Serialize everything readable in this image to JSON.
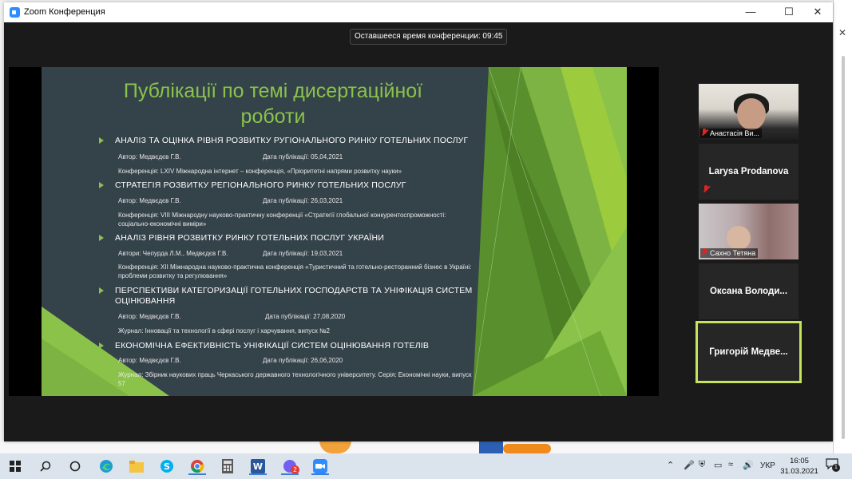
{
  "window": {
    "title": "Zoom Конференция",
    "timer": "Оставшееся время конференции: 09:45"
  },
  "slide": {
    "title": "Публікації по темі дисертаційної роботи",
    "publications": [
      {
        "heading": "АНАЛІЗ ТА ОЦІНКА РІВНЯ РОЗВИТКУ РУГІОНАЛЬНОГО РИНКУ ГОТЕЛЬНИХ ПОСЛУГ",
        "author": "Автор: Медвєдєв Г.В.",
        "date": "Дата публікації: 05,04,2021",
        "detail": "Конференція:  LXIV Міжнародна інтернет – конференція, «Пріоритетні напрями розвитку науки»"
      },
      {
        "heading": "СТРАТЕГІЯ РОЗВИТКУ РЕГІОНАЛЬНОГО РИНКУ ГОТЕЛЬНИХ ПОСЛУГ",
        "author": "Автор: Медвєдєв Г.В.",
        "date": "Дата публікації: 26,03,2021",
        "detail": "Конференція: VIII Міжнародну науково-практичну конференції «Стратегії глобальної конкурентоспроможності: соціально-економічні виміри»"
      },
      {
        "heading": "АНАЛІЗ РІВНЯ РОЗВИТКУ РИНКУ ГОТЕЛЬНИХ ПОСЛУГ УКРАЇНИ",
        "author": "Автори: Чепурда Л.М., Медвєдєв Г.В.",
        "date": "Дата публікації: 19,03,2021",
        "detail": "Конференція: XII Міжнародна науково-практична конференція «Туристичний та готельно-ресторанний бізнес в Україні: проблеми розвитку та регулювання»"
      },
      {
        "heading": "ПЕРСПЕКТИВИ КАТЕГОРИЗАЦІЇ ГОТЕЛЬНИХ ГОСПОДАРСТВ ТА УНІФІКАЦІЯ СИСТЕМ ОЦІНЮВАННЯ",
        "author": "Автор: Медвєдєв Г.В.",
        "date": "Дата публікації: 27,08,2020",
        "detail": "Журнал: Інновації та технології в сфері послуг і харчування, випуск №2"
      },
      {
        "heading": "ЕКОНОМІЧНА ЕФЕКТИВНІСТЬ УНІФІКАЦІЇ СИСТЕМ ОЦІНЮВАННЯ ГОТЕЛІВ",
        "author": "Автор: Медвєдєв Г.В.",
        "date": "Дата публікації: 26,06,2020",
        "detail": "Журнал: Збірник наукових праць Черкаського державного технологічного університету. Серія: Економічні науки, випуск 57"
      }
    ]
  },
  "participants": [
    {
      "name": "Анастасія Ви...",
      "video": true,
      "muted": true
    },
    {
      "name": "Larysa Prodanova",
      "video": false,
      "muted": true
    },
    {
      "name": "Сахно Тетяна",
      "video": true,
      "muted": true
    },
    {
      "name": "Оксана  Володи...",
      "video": false,
      "muted": false
    },
    {
      "name": "Григорій  Медве...",
      "video": false,
      "muted": false,
      "active_speaker": true
    }
  ],
  "colors": {
    "slide_bg": "#34424a",
    "slide_accent": "#8bc34a",
    "active_speaker_border": "#c6e35c",
    "muted_mic": "#e02424"
  },
  "taskbar": {
    "icons": [
      "windows-start-icon",
      "search-icon",
      "task-view-icon",
      "edge-icon",
      "file-explorer-icon",
      "skype-icon",
      "chrome-icon",
      "calculator-icon",
      "word-icon",
      "viber-icon",
      "zoom-icon"
    ],
    "viber_badge": "2",
    "language": "УКР",
    "time": "16:05",
    "date": "31.03.2021",
    "notification_count": "1"
  }
}
